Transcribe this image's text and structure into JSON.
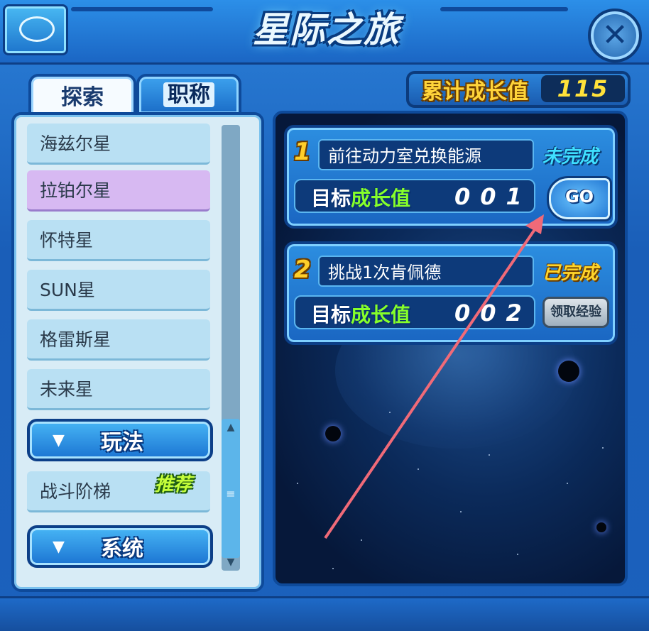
{
  "header": {
    "title": "星际之旅",
    "close_glyph": "✕"
  },
  "tabs": [
    {
      "label": "探索",
      "active": true
    },
    {
      "label": "职称",
      "active": false
    }
  ],
  "explore_list": [
    {
      "label": "海兹尔星",
      "selected": false
    },
    {
      "label": "拉铂尔星",
      "selected": true
    },
    {
      "label": "怀特星",
      "selected": false
    },
    {
      "label": "SUN星",
      "selected": false
    },
    {
      "label": "格雷斯星",
      "selected": false
    },
    {
      "label": "未来星",
      "selected": false
    }
  ],
  "sections": [
    {
      "label": "玩法",
      "arrow": "▼"
    },
    {
      "label": "系统",
      "arrow": "▼"
    }
  ],
  "gameplay_items": [
    {
      "label": "战斗阶梯",
      "badge": "推荐"
    }
  ],
  "growth": {
    "label": "累计成长值",
    "value": "115"
  },
  "tasks": [
    {
      "number": "1",
      "name": "前往动力室兑换能源",
      "status": "未完成",
      "target_label_a": "目标",
      "target_label_b": "成长值",
      "target_value": "001",
      "action": "GO"
    },
    {
      "number": "2",
      "name": "挑战1次肯佩德",
      "status": "已完成",
      "target_label_a": "目标",
      "target_label_b": "成长值",
      "target_value": "002",
      "action": "领取经验"
    }
  ],
  "colors": {
    "accent": "#1b66c4",
    "selected_item": "#d7b9f2",
    "status_todo": "#3fe0ff",
    "status_done": "#ffd52a",
    "annotation_arrow": "#f06a78"
  }
}
